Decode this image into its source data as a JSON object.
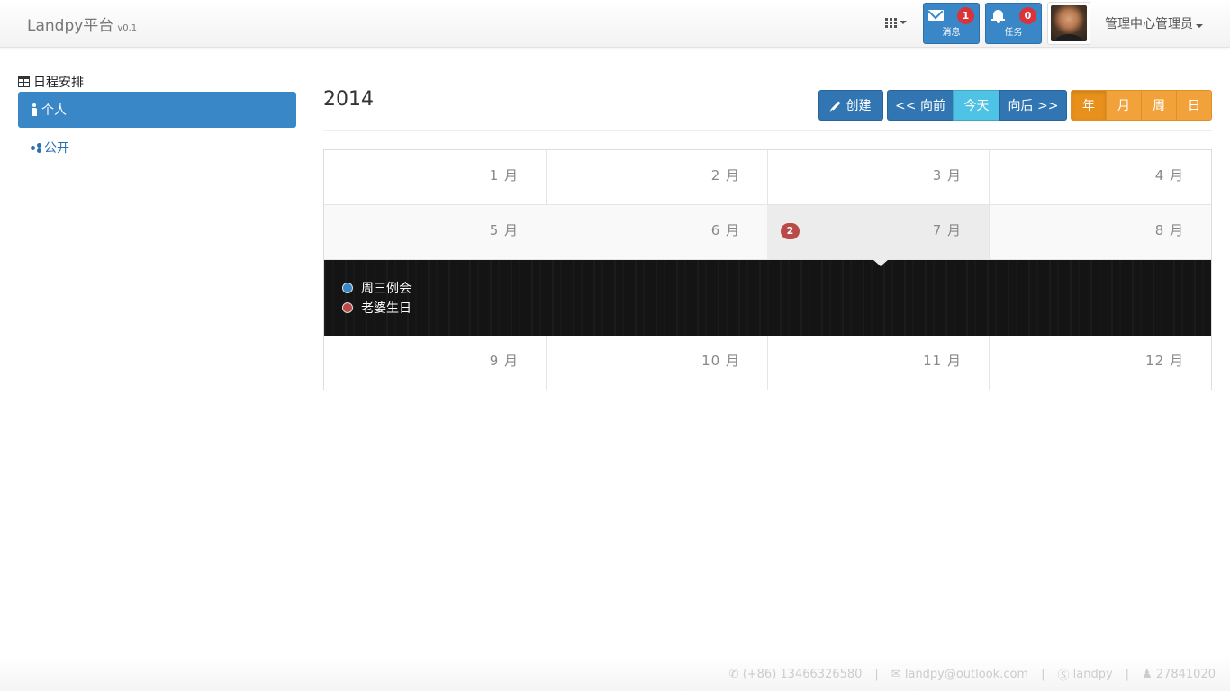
{
  "brand": {
    "name": "Landpy平台",
    "version": "v0.1"
  },
  "navbar": {
    "messages": {
      "label": "消息",
      "count": "1"
    },
    "tasks": {
      "label": "任务",
      "count": "0"
    },
    "user_menu": "管理中心管理员"
  },
  "sidebar": {
    "title": "日程安排",
    "items": [
      {
        "label": "个人",
        "active": true
      },
      {
        "label": "公开",
        "active": false
      }
    ]
  },
  "calendar": {
    "year": "2014",
    "buttons": {
      "create": "创建",
      "prev": "<< 向前",
      "today": "今天",
      "next": "向后 >>"
    },
    "views": [
      "年",
      "月",
      "周",
      "日"
    ],
    "active_view": "年",
    "months": [
      "1 月",
      "2 月",
      "3 月",
      "4 月",
      "5 月",
      "6 月",
      "7 月",
      "8 月",
      "9 月",
      "10 月",
      "11 月",
      "12 月"
    ],
    "selected_month": "7 月",
    "selected_month_event_count": "2",
    "events": [
      {
        "title": "周三例会",
        "color": "#3a87c8"
      },
      {
        "title": "老婆生日",
        "color": "#b94a48"
      }
    ]
  },
  "footer": {
    "phone": "(+86) 13466326580",
    "email": "landpy@outlook.com",
    "skype": "landpy",
    "qq": "27841020"
  },
  "colors": {
    "primary": "#3a87c8",
    "info": "#4ec3e5",
    "warning": "#f1a23a",
    "danger": "#d9343a"
  }
}
